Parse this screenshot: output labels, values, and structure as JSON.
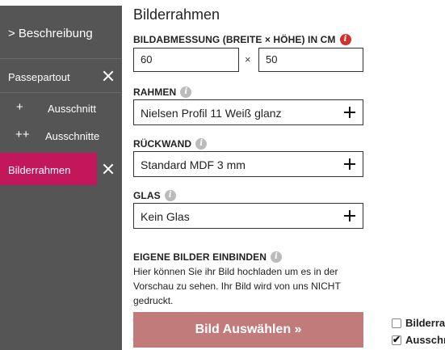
{
  "sidebar": {
    "description": "> Beschreibung",
    "passepartout": "Passepartout",
    "sub1": {
      "sign": "+",
      "label": "Ausschnitt"
    },
    "sub2": {
      "sign": "++",
      "label": "Ausschnitte"
    },
    "bilderrahmen": "Bilderrahmen"
  },
  "main": {
    "title": "Bilderrahmen",
    "dimensions": {
      "label": "BILDABMESSUNG (BREITE × HÖHE) IN CM",
      "width": "60",
      "times": "×",
      "height": "50"
    },
    "rahmen": {
      "label": "RAHMEN",
      "value": "Nielsen Profil 11 Weiß glanz"
    },
    "rueckwand": {
      "label": "RÜCKWAND",
      "value": "Standard MDF 3 mm"
    },
    "glas": {
      "label": "GLAS",
      "value": "Kein Glas"
    },
    "upload": {
      "label": "EIGENE BILDER EINBINDEN",
      "description": "Hier können Sie ihr Bild hochladen um es in der Vorschau zu sehen. Ihr Bild wird von uns NICHT gedruckt.",
      "button": "Bild Auswählen »"
    }
  },
  "options": [
    {
      "label": "Bilderra",
      "checked": false
    },
    {
      "label": "Ausschn",
      "checked": true
    }
  ],
  "colors": {
    "sidebar": "#555555",
    "active": "#c2185b",
    "button": "#c27b7b",
    "info_red": "#d32f2f"
  }
}
